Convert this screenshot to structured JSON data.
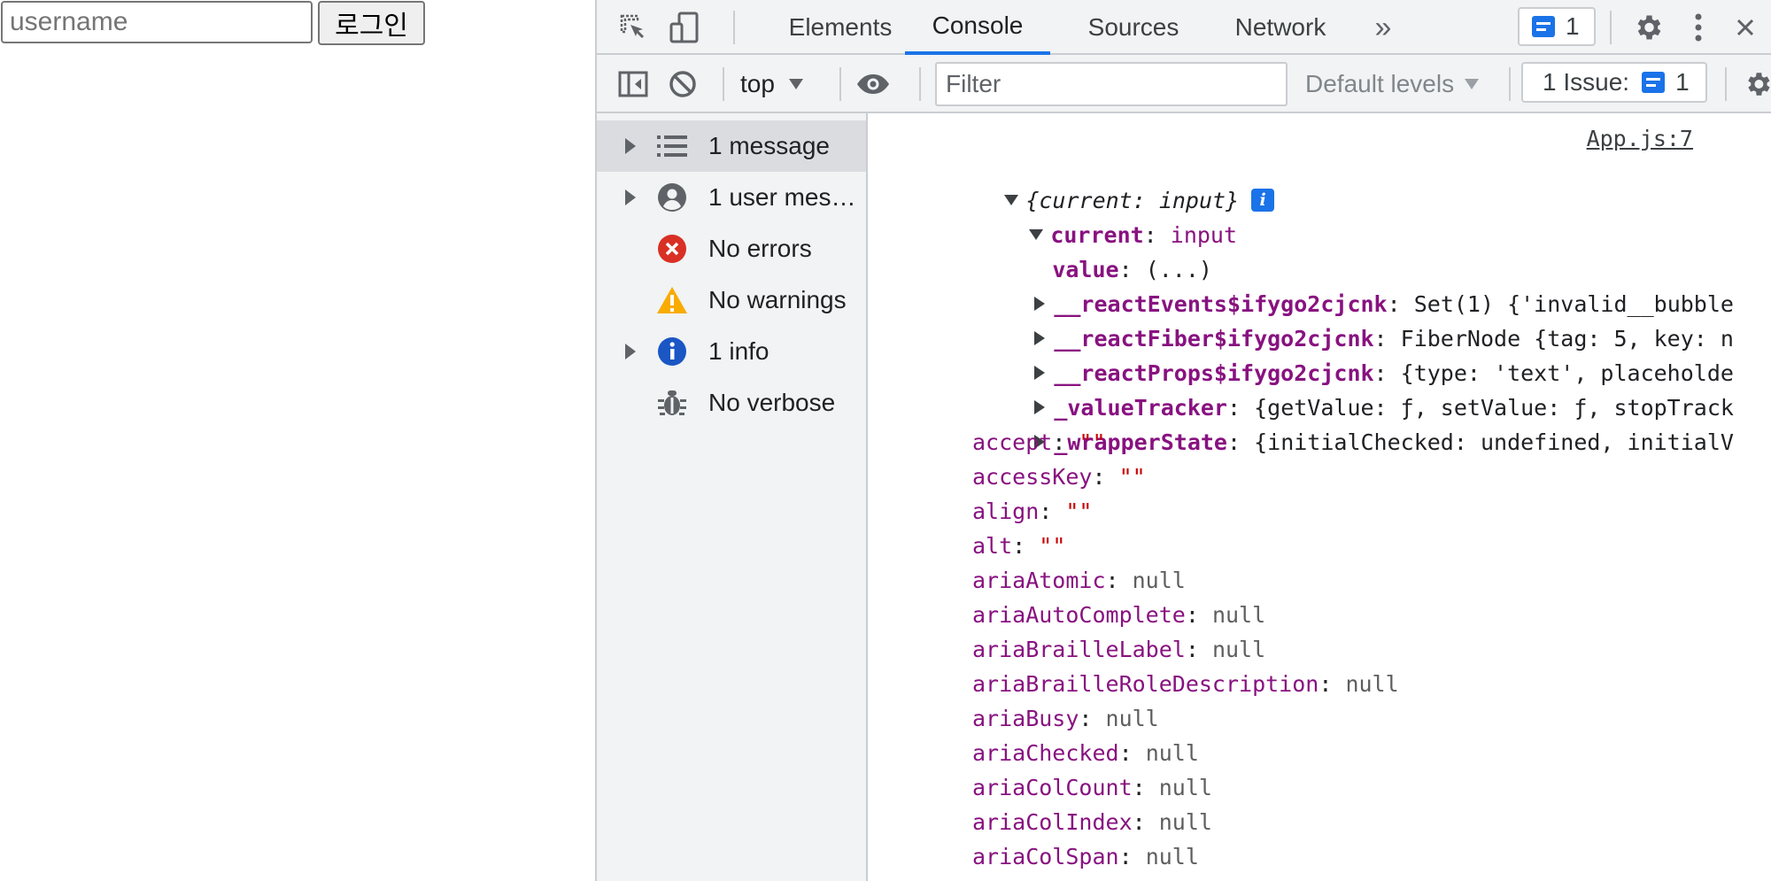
{
  "page": {
    "username_placeholder": "username",
    "login_label": "로그인"
  },
  "devtools": {
    "tabs": [
      "Elements",
      "Console",
      "Sources",
      "Network"
    ],
    "active_tab": "Console",
    "more_tabs_glyph": "»",
    "messages_badge_count": "1",
    "console_toolbar": {
      "context": "top",
      "filter_placeholder": "Filter",
      "levels_label": "Default levels",
      "issues_label": "1 Issue:",
      "issues_count": "1"
    },
    "sidebar": {
      "items": [
        {
          "label": "1 message",
          "icon": "list-icon"
        },
        {
          "label": "1 user mes…",
          "icon": "user-icon"
        },
        {
          "label": "No errors",
          "icon": "error-icon"
        },
        {
          "label": "No warnings",
          "icon": "warning-icon"
        },
        {
          "label": "1 info",
          "icon": "info-icon"
        },
        {
          "label": "No verbose",
          "icon": "bug-icon"
        }
      ]
    },
    "console": {
      "source_link": "App.js:7",
      "root_summary": "{current: input}",
      "current_key": "current",
      "current_type": "input",
      "value_key": "value",
      "value_val": "(...)",
      "expandable": [
        {
          "key": "__reactEvents$ifygo2cjcnk",
          "rest": "Set(1) {'invalid__bubble"
        },
        {
          "key": "__reactFiber$ifygo2cjcnk",
          "rest": "FiberNode {tag: 5, key: n"
        },
        {
          "key": "__reactProps$ifygo2cjcnk",
          "rest": "{type: 'text', placeholde"
        },
        {
          "key": "_valueTracker",
          "rest": "{getValue: ƒ, setValue: ƒ, stopTrack"
        },
        {
          "key": "_wrapperState",
          "rest": "{initialChecked: undefined, initialV"
        }
      ],
      "props": [
        {
          "key": "accept",
          "value": "\"\""
        },
        {
          "key": "accessKey",
          "value": "\"\""
        },
        {
          "key": "align",
          "value": "\"\""
        },
        {
          "key": "alt",
          "value": "\"\""
        },
        {
          "key": "ariaAtomic",
          "value": "null"
        },
        {
          "key": "ariaAutoComplete",
          "value": "null"
        },
        {
          "key": "ariaBrailleLabel",
          "value": "null"
        },
        {
          "key": "ariaBrailleRoleDescription",
          "value": "null"
        },
        {
          "key": "ariaBusy",
          "value": "null"
        },
        {
          "key": "ariaChecked",
          "value": "null"
        },
        {
          "key": "ariaColCount",
          "value": "null"
        },
        {
          "key": "ariaColIndex",
          "value": "null"
        },
        {
          "key": "ariaColSpan",
          "value": "null"
        }
      ]
    },
    "colors": {
      "accent": "#1a73e8",
      "error": "#d93025",
      "warning": "#f9ab00",
      "property_key": "#881280",
      "string_value": "#c80000"
    }
  }
}
